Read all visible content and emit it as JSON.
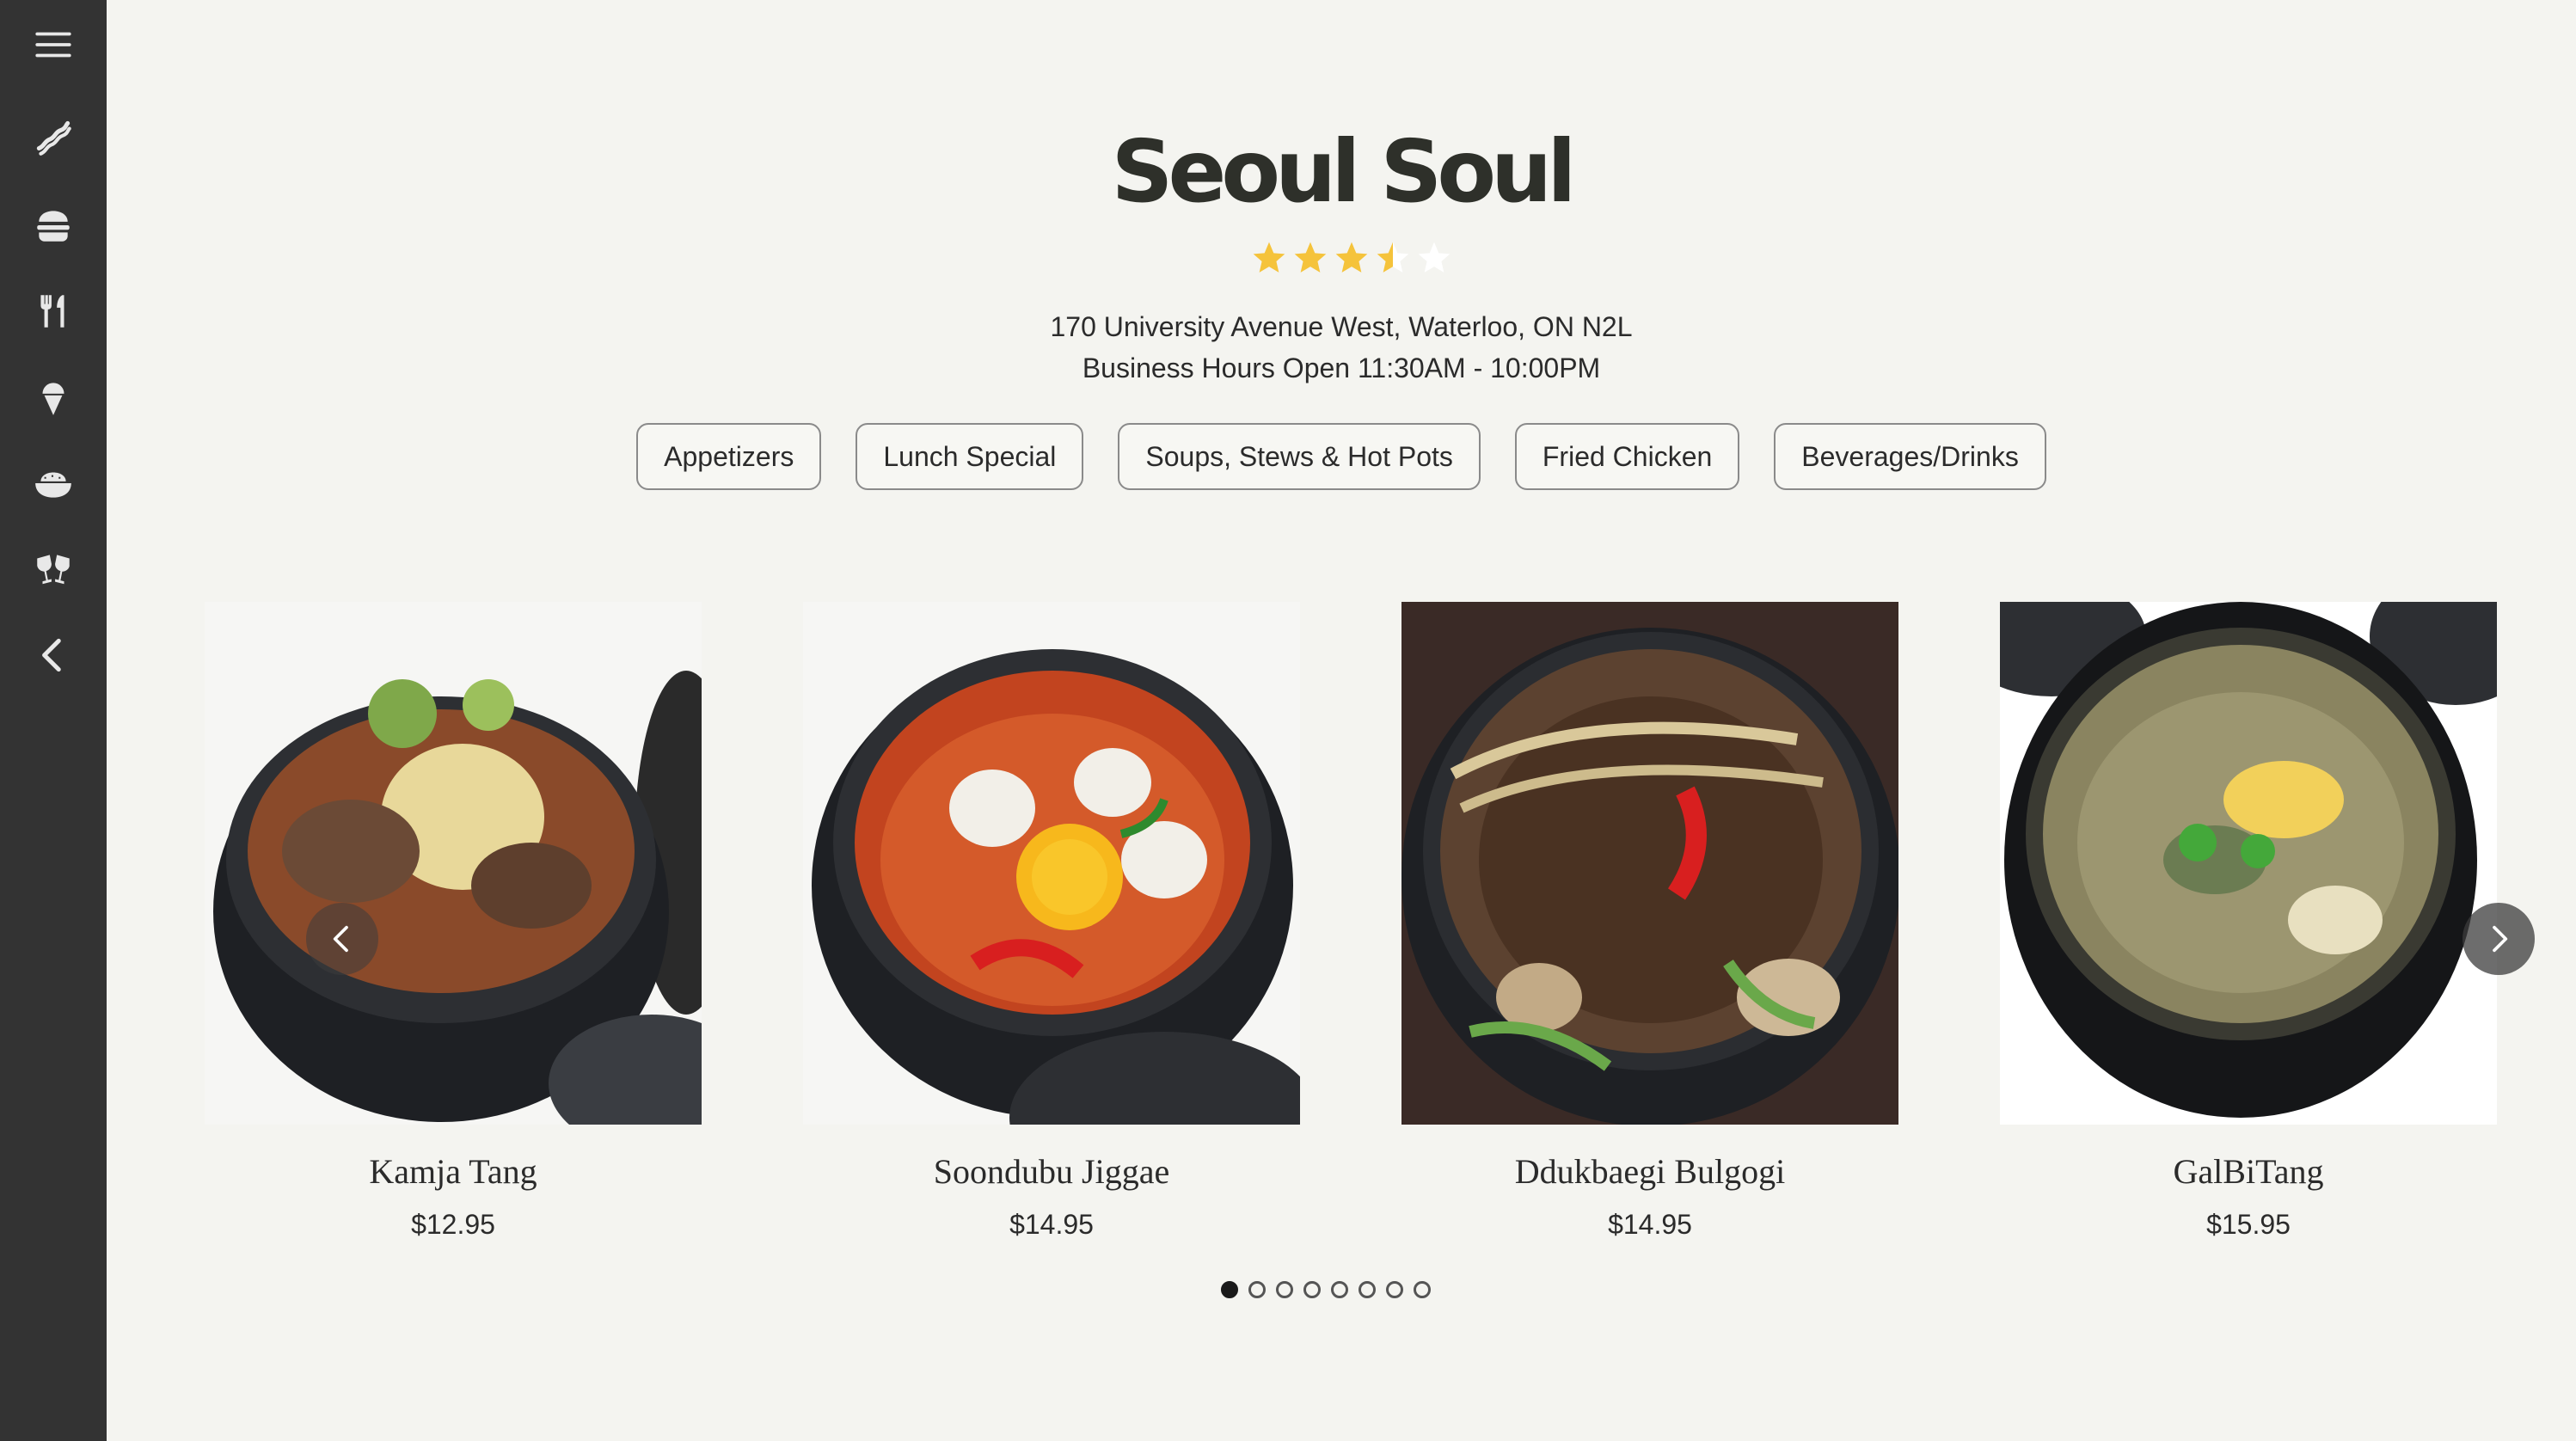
{
  "restaurant": {
    "name": "Seoul Soul",
    "rating": 3.5,
    "rating_max": 5,
    "address": "170 University Avenue West, Waterloo, ON N2L",
    "hours": "Business Hours Open 11:30AM - 10:00PM"
  },
  "sidebar": {
    "items": [
      {
        "icon": "menu-icon"
      },
      {
        "icon": "bacon-icon"
      },
      {
        "icon": "burger-icon"
      },
      {
        "icon": "utensils-icon"
      },
      {
        "icon": "ice-cream-icon"
      },
      {
        "icon": "rice-bowl-icon"
      },
      {
        "icon": "drinks-icon"
      },
      {
        "icon": "collapse-chevron-icon"
      }
    ]
  },
  "categories": [
    "Appetizers",
    "Lunch Special",
    "Soups, Stews & Hot Pots",
    "Fried Chicken",
    "Beverages/Drinks"
  ],
  "dishes": [
    {
      "name": "Kamja Tang",
      "price": "$12.95"
    },
    {
      "name": "Soondubu Jiggae",
      "price": "$14.95"
    },
    {
      "name": "Ddukbaegi Bulgogi",
      "price": "$14.95"
    },
    {
      "name": "GalBiTang",
      "price": "$15.95"
    }
  ],
  "carousel": {
    "page_count": 8,
    "active_page": 1
  },
  "colors": {
    "sidebar": "#333333",
    "background": "#f4f4f0",
    "star": "#f5c33b",
    "star_empty": "#ffffff",
    "text": "#2b2b2b"
  }
}
